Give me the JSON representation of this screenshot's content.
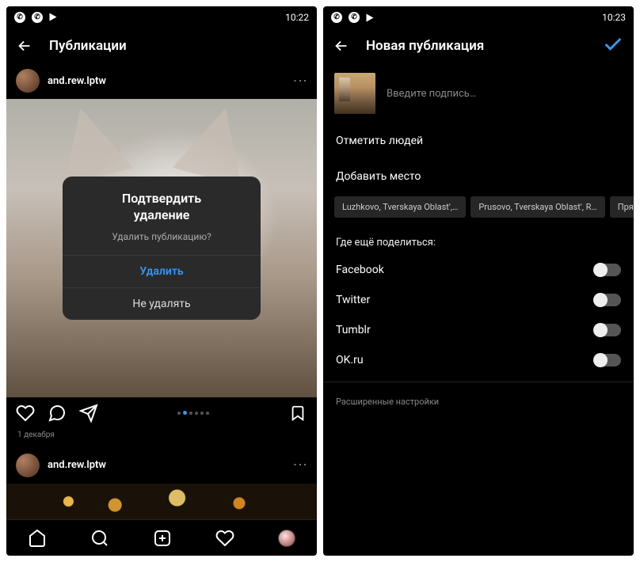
{
  "left": {
    "status_time": "10:22",
    "header_title": "Публикации",
    "post1": {
      "username": "and.rew.lptw"
    },
    "modal": {
      "title_line1": "Подтвердить",
      "title_line2": "удаление",
      "subtitle": "Удалить публикацию?",
      "confirm": "Удалить",
      "cancel": "Не удалять"
    },
    "post_date": "1 декабря",
    "post2": {
      "username": "and.rew.lptw"
    }
  },
  "right": {
    "status_time": "10:23",
    "header_title": "Новая публикация",
    "caption_placeholder": "Введите подпись…",
    "tag_people": "Отметить людей",
    "add_location": "Добавить место",
    "chips": [
      "Luzhkovo, Tverskaya Oblast',…",
      "Prusovo, Tverskaya Oblast', R…",
      "Прямух…"
    ],
    "share_section": "Где ещё поделиться:",
    "share_targets": [
      "Facebook",
      "Twitter",
      "Tumblr",
      "OK.ru"
    ],
    "advanced": "Расширенные настройки"
  }
}
